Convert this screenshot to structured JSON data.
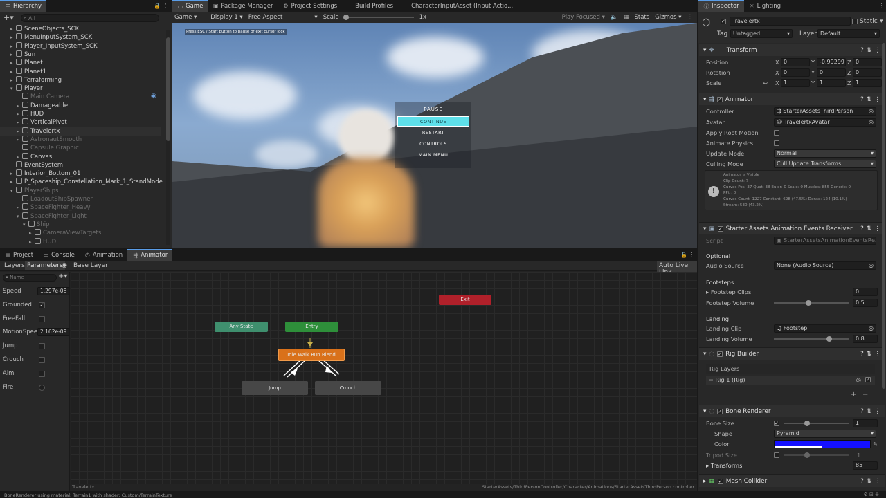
{
  "hierarchy": {
    "tab_label": "Hierarchy",
    "search_placeholder": "All",
    "items": [
      {
        "label": "SceneObjects_SCK",
        "indent": 1,
        "arrow": "▸",
        "dim": false
      },
      {
        "label": "MenuInputSystem_SCK",
        "indent": 1,
        "arrow": "▸",
        "dim": false
      },
      {
        "label": "Player_InputSystem_SCK",
        "indent": 1,
        "arrow": "▸",
        "dim": false
      },
      {
        "label": "Sun",
        "indent": 1,
        "arrow": "▸",
        "dim": false
      },
      {
        "label": "Planet",
        "indent": 1,
        "arrow": "▸",
        "dim": false
      },
      {
        "label": "Planet1",
        "indent": 1,
        "arrow": "▸",
        "dim": false
      },
      {
        "label": "Terraforming",
        "indent": 1,
        "arrow": "▸",
        "dim": false
      },
      {
        "label": "Player",
        "indent": 1,
        "arrow": "▾",
        "dim": false
      },
      {
        "label": "Main Camera",
        "indent": 2,
        "arrow": "",
        "dim": true
      },
      {
        "label": "Damageable",
        "indent": 2,
        "arrow": "▸",
        "dim": false
      },
      {
        "label": "HUD",
        "indent": 2,
        "arrow": "▸",
        "dim": false
      },
      {
        "label": "VerticalPivot",
        "indent": 2,
        "arrow": "▸",
        "dim": false
      },
      {
        "label": "Travelertx",
        "indent": 2,
        "arrow": "▸",
        "dim": false,
        "selected": true
      },
      {
        "label": "AstronautSmooth",
        "indent": 2,
        "arrow": "▸",
        "dim": true
      },
      {
        "label": "Capsule Graphic",
        "indent": 2,
        "arrow": "",
        "dim": true
      },
      {
        "label": "Canvas",
        "indent": 2,
        "arrow": "▸",
        "dim": false
      },
      {
        "label": "EventSystem",
        "indent": 1,
        "arrow": "",
        "dim": false
      },
      {
        "label": "Interior_Bottom_01",
        "indent": 1,
        "arrow": "▸",
        "dim": false
      },
      {
        "label": "P_Spaceship_Constellation_Mark_1_StandMode",
        "indent": 1,
        "arrow": "▸",
        "dim": false
      },
      {
        "label": "PlayerShips",
        "indent": 1,
        "arrow": "▾",
        "dim": true
      },
      {
        "label": "LoadoutShipSpawner",
        "indent": 2,
        "arrow": "",
        "dim": true
      },
      {
        "label": "SpaceFighter_Heavy",
        "indent": 2,
        "arrow": "▸",
        "dim": true
      },
      {
        "label": "SpaceFighter_Light",
        "indent": 2,
        "arrow": "▾",
        "dim": true
      },
      {
        "label": "Ship",
        "indent": 3,
        "arrow": "▾",
        "dim": true
      },
      {
        "label": "CameraViewTargets",
        "indent": 4,
        "arrow": "▸",
        "dim": true
      },
      {
        "label": "HUD",
        "indent": 4,
        "arrow": "▸",
        "dim": true
      }
    ]
  },
  "game": {
    "tabs": [
      {
        "label": "Game",
        "active": true
      },
      {
        "label": "Package Manager",
        "active": false
      },
      {
        "label": "Project Settings",
        "active": false
      },
      {
        "label": "Build Profiles",
        "active": false
      },
      {
        "label": "CharacterInputAsset (Input Actio...",
        "active": false
      }
    ],
    "toolbar": {
      "mode": "Game",
      "display": "Display 1",
      "aspect": "Free Aspect",
      "scale_label": "Scale",
      "scale_value": "1x",
      "play_focused": "Play Focused",
      "stats": "Stats",
      "gizmos": "Gizmos"
    },
    "hint": "Press ESC / Start button to pause or exit cursor lock",
    "pause_menu": {
      "title": "PAUSE",
      "items": [
        {
          "label": "CONTINUE",
          "highlighted": true
        },
        {
          "label": "RESTART",
          "highlighted": false
        },
        {
          "label": "CONTROLS",
          "highlighted": false
        },
        {
          "label": "MAIN MENU",
          "highlighted": false
        }
      ]
    }
  },
  "bottom": {
    "tabs": [
      {
        "label": "Project",
        "active": false
      },
      {
        "label": "Console",
        "active": false
      },
      {
        "label": "Animation",
        "active": false
      },
      {
        "label": "Animator",
        "active": true
      }
    ],
    "subtabs": {
      "layers": "Layers",
      "parameters": "Parameters"
    },
    "base_layer": "Base Layer",
    "auto_live_link": "Auto Live Link",
    "param_search_placeholder": "Name",
    "parameters": [
      {
        "name": "Speed",
        "type": "float",
        "value": "1.297e-08"
      },
      {
        "name": "Grounded",
        "type": "bool",
        "value": "✓"
      },
      {
        "name": "FreeFall",
        "type": "bool",
        "value": ""
      },
      {
        "name": "MotionSpeed",
        "type": "float",
        "value": "2.162e-09"
      },
      {
        "name": "Jump",
        "type": "bool",
        "value": ""
      },
      {
        "name": "Crouch",
        "type": "bool",
        "value": ""
      },
      {
        "name": "Aim",
        "type": "bool",
        "value": ""
      },
      {
        "name": "Fire",
        "type": "trigger",
        "value": ""
      }
    ],
    "nodes": {
      "any_state": "Any State",
      "entry": "Entry",
      "exit": "Exit",
      "blend": "Idle Walk Run Blend",
      "jump": "Jump",
      "crouch": "Crouch"
    },
    "footer_left": "Travelertx",
    "footer_path": "StarterAssets/ThirdPersonController/Character/Animations/StarterAssetsThirdPerson.controller"
  },
  "inspector": {
    "tabs": [
      {
        "label": "Inspector",
        "active": true
      },
      {
        "label": "Lighting",
        "active": false
      }
    ],
    "object_name": "Travelertx",
    "static_label": "Static",
    "tag_label": "Tag",
    "tag_value": "Untagged",
    "layer_label": "Layer",
    "layer_value": "Default",
    "transform": {
      "title": "Transform",
      "position": {
        "label": "Position",
        "x": "0",
        "y": "-0.99299",
        "z": "0"
      },
      "rotation": {
        "label": "Rotation",
        "x": "0",
        "y": "0",
        "z": "0"
      },
      "scale": {
        "label": "Scale",
        "x": "1",
        "y": "1",
        "z": "1"
      }
    },
    "animator": {
      "title": "Animator",
      "controller_label": "Controller",
      "controller_value": "StarterAssetsThirdPerson",
      "avatar_label": "Avatar",
      "avatar_value": "TravelertxAvatar",
      "apply_root_motion": "Apply Root Motion",
      "animate_physics": "Animate Physics",
      "update_mode_label": "Update Mode",
      "update_mode_value": "Normal",
      "culling_mode_label": "Culling Mode",
      "culling_mode_value": "Cull Update Transforms",
      "info_lines": [
        "Animator is Visible",
        "Clip Count: 7",
        "Curves Pos: 37 Quat: 38 Euler: 0 Scale: 0 Muscles: 855 Generic: 0",
        "PPtr: 0",
        "Curves Count: 1227 Constant: 628 (47.5%) Dense: 124 (10.1%)",
        "Stream: 530 (43.2%)"
      ]
    },
    "events_receiver": {
      "title": "Starter Assets Animation Events Receiver (Scri",
      "script_label": "Script",
      "script_value": "StarterAssetsAnimationEventsRe...",
      "optional_label": "Optional",
      "audio_source_label": "Audio Source",
      "audio_source_value": "None (Audio Source)",
      "footsteps_label": "Footsteps",
      "footstep_clips_label": "Footstep Clips",
      "footstep_clips_value": "0",
      "footstep_volume_label": "Footstep Volume",
      "footstep_volume_value": "0.5",
      "footstep_volume_fraction": 0.5,
      "landing_label": "Landing",
      "landing_clip_label": "Landing Clip",
      "landing_clip_value": "Footstep",
      "landing_volume_label": "Landing Volume",
      "landing_volume_value": "0.8",
      "landing_volume_fraction": 0.8
    },
    "rig_builder": {
      "title": "Rig Builder",
      "rig_layers_label": "Rig Layers",
      "rig_item": "Rig 1 (Rig)"
    },
    "bone_renderer": {
      "title": "Bone Renderer",
      "bone_size_label": "Bone Size",
      "bone_size_value": "1",
      "shape_label": "Shape",
      "shape_value": "Pyramid",
      "color_label": "Color",
      "color_value": "#1410ff",
      "tripod_size_label": "Tripod Size",
      "tripod_size_value": "1",
      "transforms_label": "Transforms",
      "transforms_value": "85"
    },
    "mesh_collider": {
      "title": "Mesh Collider"
    }
  },
  "status_bar": {
    "message": "BoneRenderer using material: Terrain1 with shader: Custom/TerrainTexture"
  },
  "colors": {
    "accent": "#5a9de8",
    "continue_highlight": "#5ee0ea",
    "node_any_state": "#3f8f6e",
    "node_entry": "#2e8f3a",
    "node_exit": "#b0202a",
    "node_blend": "#d9711a",
    "node_default": "#474747"
  }
}
